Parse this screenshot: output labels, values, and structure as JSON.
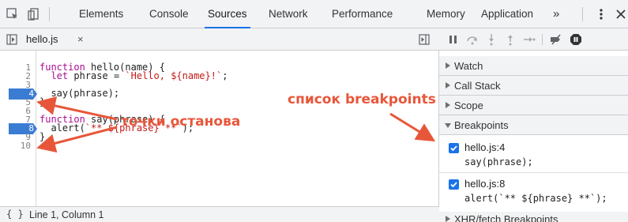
{
  "devtools": {
    "tabs": [
      {
        "label": "Elements"
      },
      {
        "label": "Console"
      },
      {
        "label": "Sources"
      },
      {
        "label": "Network"
      },
      {
        "label": "Performance"
      },
      {
        "label": "Memory"
      },
      {
        "label": "Application"
      },
      {
        "label": "»"
      }
    ],
    "active_tab": "Sources",
    "accent_color": "#1a73e8",
    "breakpoint_color": "#3b7cd3",
    "annotation_color": "#e8563a",
    "icons": [
      "inspect-element-icon",
      "device-toolbar-icon",
      "more-options-icon",
      "close-icon"
    ]
  },
  "editor": {
    "file_tab": {
      "name": "hello.js",
      "close": "×"
    },
    "lines": [
      {
        "num": "1",
        "text": "function hello(name) {"
      },
      {
        "num": "2",
        "text": "  let phrase = `Hello, ${name}!`;"
      },
      {
        "num": "3",
        "text": ""
      },
      {
        "num": "4",
        "text": "  say(phrase);",
        "breakpoint": true
      },
      {
        "num": "5",
        "text": "}"
      },
      {
        "num": "6",
        "text": ""
      },
      {
        "num": "7",
        "text": "function say(phrase) {"
      },
      {
        "num": "8",
        "text": "  alert(`** ${phrase} **`);",
        "breakpoint": true
      },
      {
        "num": "9",
        "text": "}"
      },
      {
        "num": "10",
        "text": ""
      }
    ]
  },
  "annotations": {
    "breakpoints_label": "точки останова",
    "list_label": "список breakpoints"
  },
  "status_bar": {
    "icon": "{ }",
    "position": "Line 1, Column 1"
  },
  "debugger": {
    "toolbar_icons": [
      "pause-icon",
      "step-over-icon",
      "step-into-icon",
      "step-out-icon",
      "step-icon",
      "deactivate-breakpoints-icon",
      "pause-on-exceptions-icon"
    ],
    "sections": [
      {
        "label": "Watch",
        "expanded": false
      },
      {
        "label": "Call Stack",
        "expanded": false
      },
      {
        "label": "Scope",
        "expanded": false
      },
      {
        "label": "Breakpoints",
        "expanded": true
      },
      {
        "label": "XHR/fetch Breakpoints",
        "expanded": false
      }
    ],
    "breakpoints": [
      {
        "file": "hello.js:4",
        "code": "say(phrase);",
        "checked": true
      },
      {
        "file": "hello.js:8",
        "code": "alert(`** ${phrase} **`);",
        "checked": true
      }
    ]
  }
}
